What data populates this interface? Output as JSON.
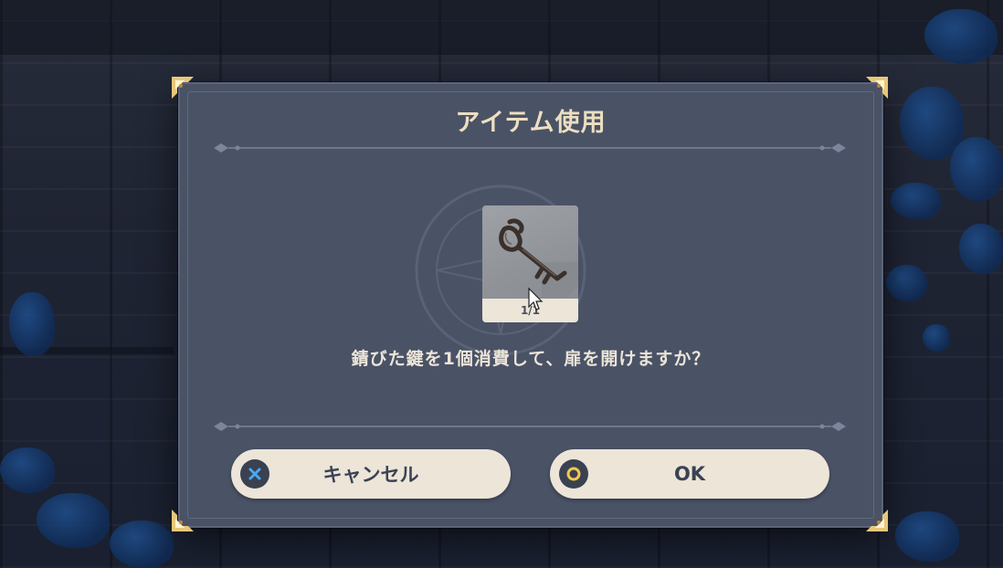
{
  "dialog": {
    "title": "アイテム使用",
    "item": {
      "icon": "rusty-key-icon",
      "count": "1/1"
    },
    "message": "錆びた鍵を1個消費して、扉を開けますか？",
    "buttons": {
      "cancel": {
        "label": "キャンセル",
        "icon": "cross-icon",
        "icon_color": "#4aa8f0"
      },
      "ok": {
        "label": "OK",
        "icon": "circle-icon",
        "icon_color": "#f2c84b"
      }
    }
  },
  "colors": {
    "panel": "#4a5266",
    "title": "#ecdfc0",
    "button_bg": "#ece5d8",
    "button_text": "#3b4254"
  }
}
